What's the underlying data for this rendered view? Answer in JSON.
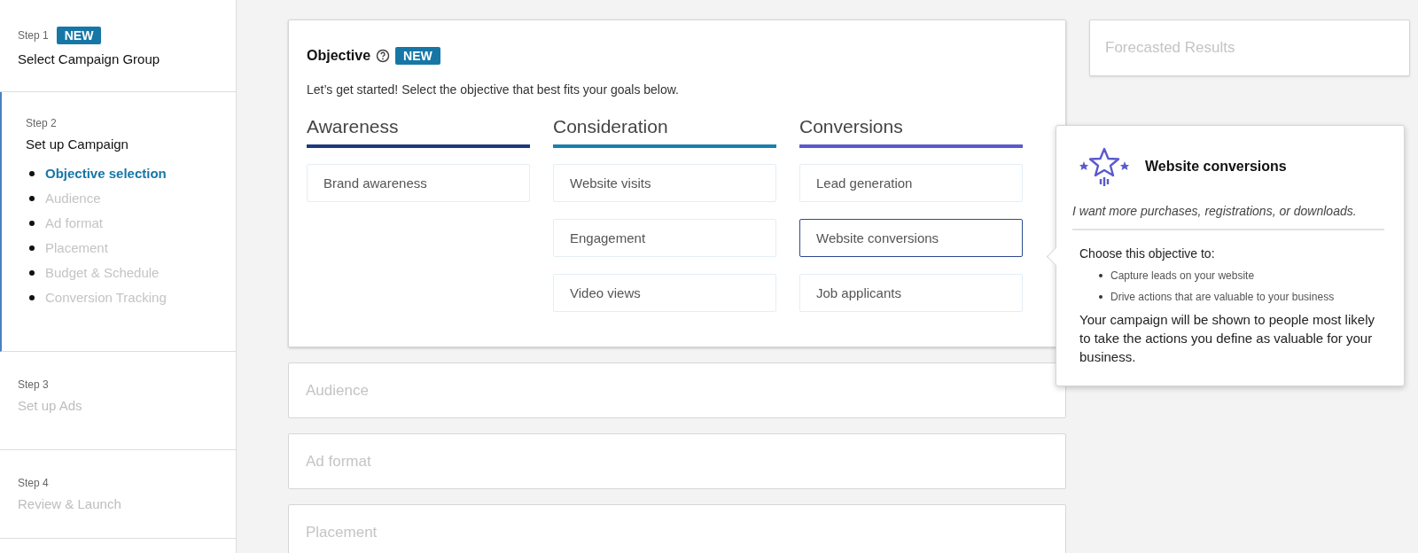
{
  "sidebar": {
    "steps": [
      {
        "step": "Step 1",
        "badge": "NEW",
        "title": "Select Campaign Group",
        "selected": false,
        "disabled": false
      },
      {
        "step": "Step 2",
        "title": "Set up Campaign",
        "selected": true,
        "disabled": false,
        "items": [
          {
            "label": "Objective selection",
            "selected": true
          },
          {
            "label": "Audience",
            "selected": false
          },
          {
            "label": "Ad format",
            "selected": false
          },
          {
            "label": "Placement",
            "selected": false
          },
          {
            "label": "Budget & Schedule",
            "selected": false
          },
          {
            "label": "Conversion Tracking",
            "selected": false
          }
        ]
      },
      {
        "step": "Step 3",
        "title": "Set up Ads",
        "selected": false,
        "disabled": true
      },
      {
        "step": "Step 4",
        "title": "Review & Launch",
        "selected": false,
        "disabled": true
      }
    ]
  },
  "objective": {
    "title": "Objective",
    "badge": "NEW",
    "intro": "Let’s get started! Select the objective that best fits your goals below.",
    "columns": [
      {
        "name": "Awareness",
        "color": "#1d3a7c",
        "options": [
          {
            "label": "Brand awareness",
            "selected": false
          }
        ]
      },
      {
        "name": "Consideration",
        "color": "#1a7fad",
        "options": [
          {
            "label": "Website visits",
            "selected": false
          },
          {
            "label": "Engagement",
            "selected": false
          },
          {
            "label": "Video views",
            "selected": false
          }
        ]
      },
      {
        "name": "Conversions",
        "color": "#5a5acd",
        "options": [
          {
            "label": "Lead generation",
            "selected": false
          },
          {
            "label": "Website conversions",
            "selected": true
          },
          {
            "label": "Job applicants",
            "selected": false
          }
        ]
      }
    ]
  },
  "popover": {
    "title": "Website conversions",
    "tagline": "I want more purchases, registrations, or downloads.",
    "heading": "Choose this objective to:",
    "bullets": [
      "Capture leads on your website",
      "Drive actions that are valuable to your business"
    ],
    "description": "Your campaign will be shown to people most likely to take the actions you define as valuable for your business."
  },
  "sections": [
    "Audience",
    "Ad format",
    "Placement"
  ],
  "forecast": {
    "title": "Forecasted Results"
  }
}
